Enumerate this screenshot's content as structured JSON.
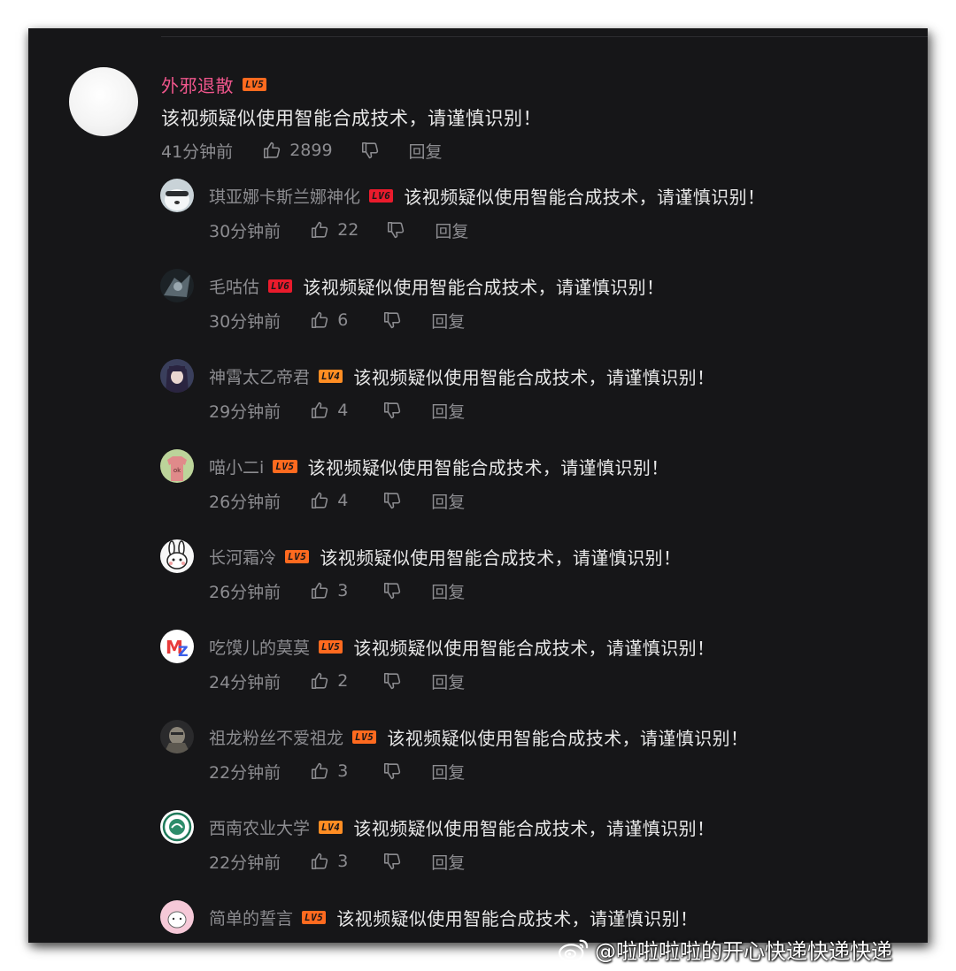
{
  "top_comment": {
    "username": "外邪退散",
    "level": "LV5",
    "text": "该视频疑似使用智能合成技术，请谨慎识别！",
    "time": "41分钟前",
    "likes": "2899",
    "reply_label": "回复"
  },
  "replies": [
    {
      "username": "琪亚娜卡斯兰娜神化",
      "level": "LV6",
      "text": "该视频疑似使用智能合成技术，请谨慎识别！",
      "time": "30分钟前",
      "likes": "22",
      "reply_label": "回复",
      "avatar": "husky-avatar"
    },
    {
      "username": "毛咕估",
      "level": "LV6",
      "text": "该视频疑似使用智能合成技术，请谨慎识别！",
      "time": "30分钟前",
      "likes": "6",
      "reply_label": "回复",
      "avatar": "dark-character-avatar"
    },
    {
      "username": "神霄太乙帝君",
      "level": "LV4",
      "text": "该视频疑似使用智能合成技术，请谨慎识别！",
      "time": "29分钟前",
      "likes": "4",
      "reply_label": "回复",
      "avatar": "anime-girl-avatar"
    },
    {
      "username": "喵小二i",
      "level": "LV5",
      "text": "该视频疑似使用智能合成技术，请谨慎识别！",
      "time": "26分钟前",
      "likes": "4",
      "reply_label": "回复",
      "avatar": "pink-tshirt-avatar"
    },
    {
      "username": "长河霜冷",
      "level": "LV5",
      "text": "该视频疑似使用智能合成技术，请谨慎识别！",
      "time": "26分钟前",
      "likes": "3",
      "reply_label": "回复",
      "avatar": "cartoon-rabbit-avatar"
    },
    {
      "username": "吃馍儿的莫莫",
      "level": "LV5",
      "text": "该视频疑似使用智能合成技术，请谨慎识别！",
      "time": "24分钟前",
      "likes": "2",
      "reply_label": "回复",
      "avatar": "mz-letter-avatar"
    },
    {
      "username": "祖龙粉丝不爱祖龙",
      "level": "LV5",
      "text": "该视频疑似使用智能合成技术，请谨慎识别！",
      "time": "22分钟前",
      "likes": "3",
      "reply_label": "回复",
      "avatar": "armored-character-avatar"
    },
    {
      "username": "西南农业大学",
      "level": "LV4",
      "text": "该视频疑似使用智能合成技术，请谨慎识别！",
      "time": "22分钟前",
      "likes": "3",
      "reply_label": "回复",
      "avatar": "university-emblem-avatar"
    },
    {
      "username": "简单的誓言",
      "level": "LV5",
      "text": "该视频疑似使用智能合成技术，请谨慎识别！",
      "time": "",
      "likes": "",
      "reply_label": "",
      "avatar": "pink-sketch-avatar"
    }
  ],
  "watermark": {
    "text": "@啦啦啦啦的开心快递快递快递",
    "icon": "weibo-logo-icon"
  },
  "colors": {
    "background": "#161618",
    "top_username": "#f0568c",
    "secondary_text": "#8c8c90",
    "primary_text": "#e8e8e8",
    "lv5": "#ff6a1f",
    "lv6": "#ea1b2c",
    "lv4": "#ff8d23"
  }
}
